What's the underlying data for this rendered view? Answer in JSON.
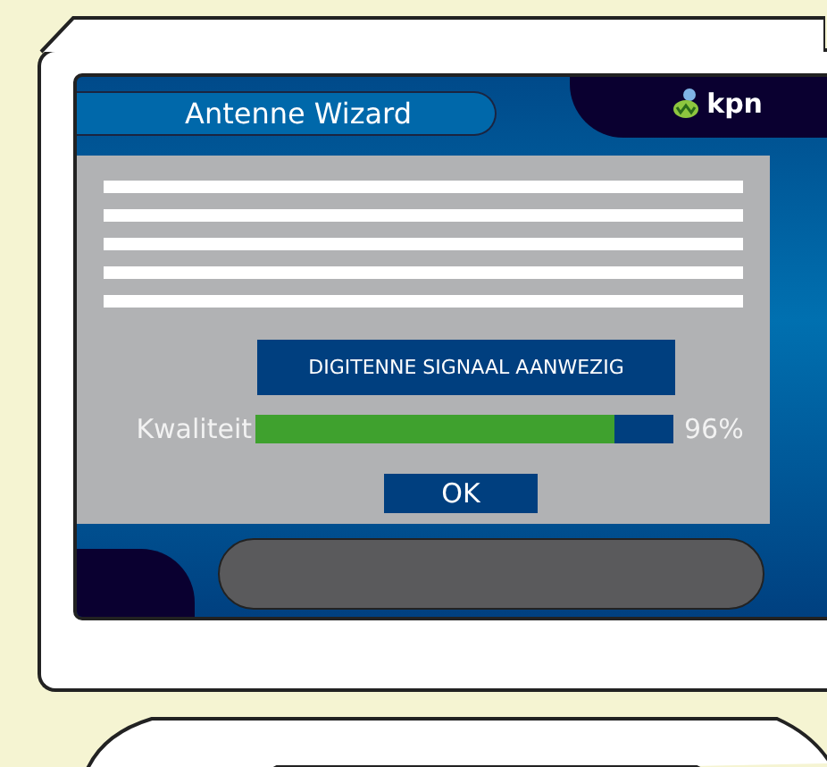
{
  "wizard": {
    "title": "Antenne Wizard",
    "logo_text": "kpn"
  },
  "status": "DIGITENNE SIGNAAL AANWEZIG",
  "quality": {
    "label": "Kwaliteit",
    "level": 0.86,
    "reading": "96%"
  },
  "buttons": [
    "OK"
  ]
}
